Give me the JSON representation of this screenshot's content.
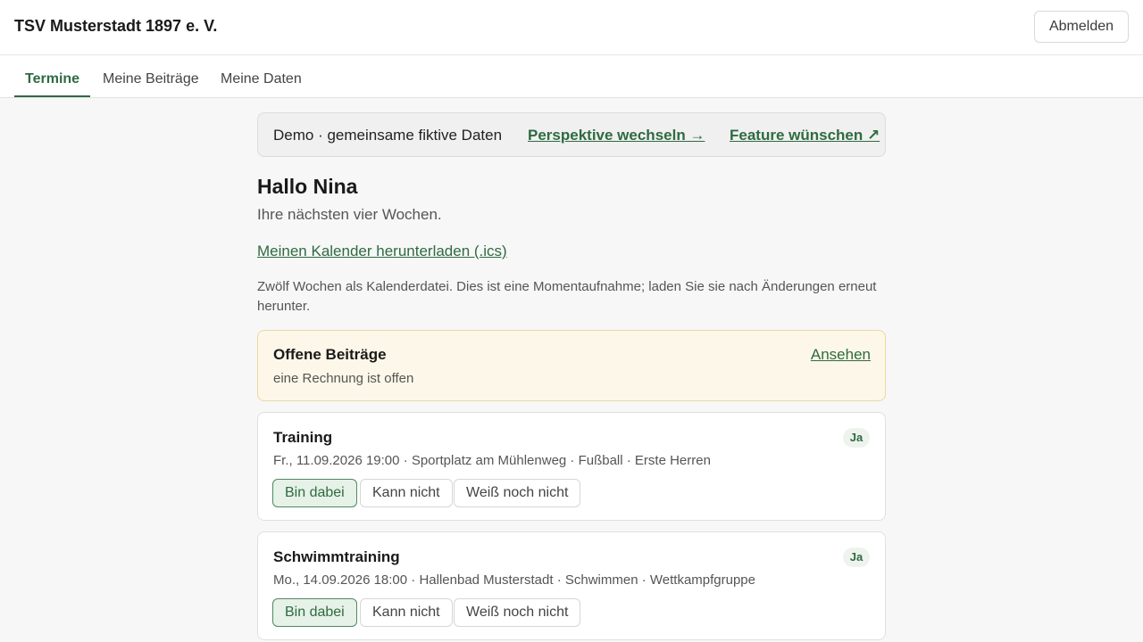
{
  "header": {
    "club_name": "TSV Musterstadt 1897 e. V.",
    "logout_label": "Abmelden"
  },
  "tabs": [
    {
      "label": "Termine",
      "active": true
    },
    {
      "label": "Meine Beiträge",
      "active": false
    },
    {
      "label": "Meine Daten",
      "active": false
    }
  ],
  "demo_bar": {
    "text": "Demo · gemeinsame fiktive Daten",
    "switch_link": "Perspektive wechseln →",
    "feature_link": "Feature wünschen ↗"
  },
  "greeting": "Hallo Nina",
  "subtitle": "Ihre nächsten vier Wochen.",
  "calendar": {
    "download_link": "Meinen Kalender herunterladen (.ics)",
    "note": "Zwölf Wochen als Kalenderdatei. Dies ist eine Momentaufnahme; laden Sie sie nach Änderungen erneut herunter."
  },
  "open_fees": {
    "title": "Offene Beiträge",
    "status": "eine Rechnung ist offen",
    "link": "Ansehen"
  },
  "events": [
    {
      "title": "Training",
      "meta": "Fr., 11.09.2026 19:00 · Sportplatz am Mühlenweg · Fußball · Erste Herren",
      "badge": "Ja",
      "rsvp": {
        "yes": "Bin dabei",
        "no": "Kann nicht",
        "maybe": "Weiß noch nicht",
        "selected": "yes"
      }
    },
    {
      "title": "Schwimmtraining",
      "meta": "Mo., 14.09.2026 18:00 · Hallenbad Musterstadt · Schwimmen · Wettkampfgruppe",
      "badge": "Ja",
      "rsvp": {
        "yes": "Bin dabei",
        "no": "Kann nicht",
        "maybe": "Weiß noch nicht",
        "selected": "yes"
      }
    }
  ],
  "colors": {
    "accent": "#2e6b40",
    "fees_background": "#fcf7e8",
    "page_background": "#f7f7f7"
  }
}
